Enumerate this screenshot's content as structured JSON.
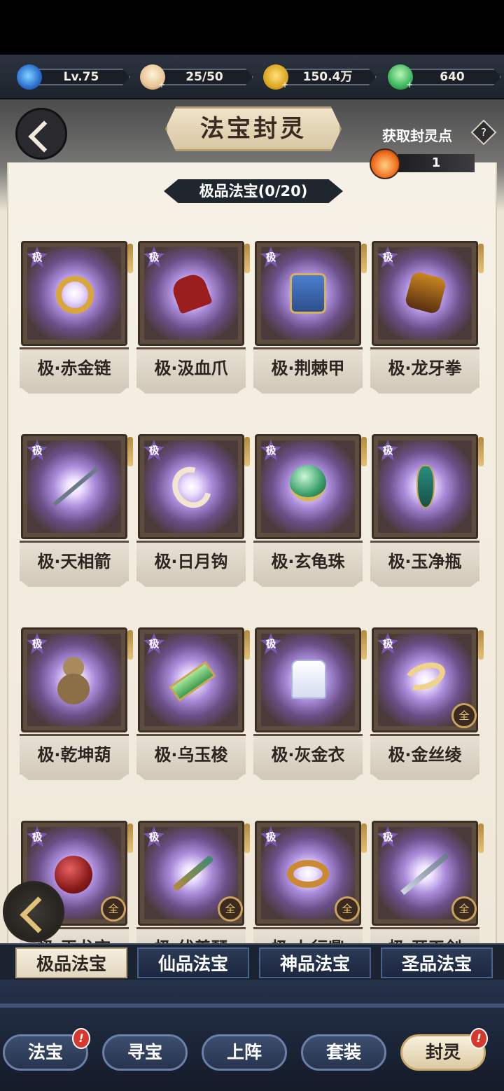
{
  "resources": {
    "level": "Lv.75",
    "stamina": "25/50",
    "coins": "150.4万",
    "jade": "640"
  },
  "header": {
    "title": "法宝封灵",
    "acquire_label": "获取封灵点",
    "help_label": "?",
    "seal_points": "1"
  },
  "section": {
    "title": "极品法宝(0/20)",
    "badge_char": "极",
    "set_char": "全"
  },
  "items": [
    {
      "name": "极·赤金链"
    },
    {
      "name": "极·汲血爪"
    },
    {
      "name": "极·荆棘甲"
    },
    {
      "name": "极·龙牙拳"
    },
    {
      "name": "极·天相箭"
    },
    {
      "name": "极·日月钩"
    },
    {
      "name": "极·玄龟珠"
    },
    {
      "name": "极·玉净瓶"
    },
    {
      "name": "极·乾坤葫"
    },
    {
      "name": "极·乌玉梭"
    },
    {
      "name": "极·灰金衣"
    },
    {
      "name": "极·金丝绫"
    },
    {
      "name": "极·玉龙宝"
    },
    {
      "name": "极·伏羲琴"
    },
    {
      "name": "极·九行鼎"
    },
    {
      "name": "极·开天剑"
    }
  ],
  "tabs": [
    {
      "label": "极品法宝"
    },
    {
      "label": "仙品法宝"
    },
    {
      "label": "神品法宝"
    },
    {
      "label": "圣品法宝"
    }
  ],
  "nav": [
    {
      "label": "法宝"
    },
    {
      "label": "寻宝"
    },
    {
      "label": "上阵"
    },
    {
      "label": "套装"
    },
    {
      "label": "封灵"
    }
  ],
  "nav_alert": "!"
}
